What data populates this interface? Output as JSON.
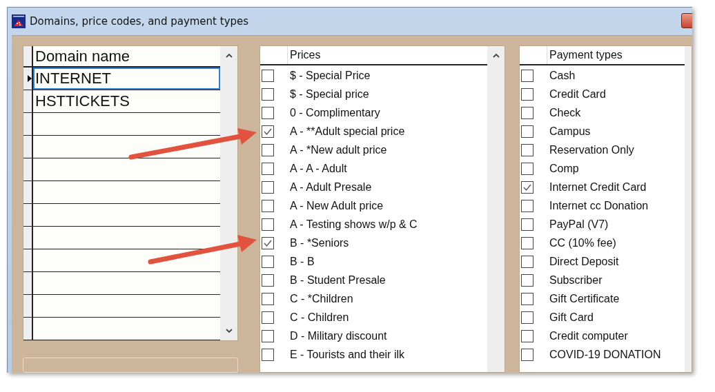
{
  "window": {
    "title": "Domains, price codes, and payment types"
  },
  "domains": {
    "header": "Domain name",
    "rows": [
      {
        "name": "INTERNET",
        "current": true
      },
      {
        "name": "HSTTICKETS",
        "current": false
      }
    ]
  },
  "prices": {
    "header": "Prices",
    "items": [
      {
        "label": "$ - Special Price",
        "checked": false
      },
      {
        "label": "$ - Special price",
        "checked": false
      },
      {
        "label": "0 - Complimentary",
        "checked": false
      },
      {
        "label": "A - **Adult special price",
        "checked": true
      },
      {
        "label": "A - *New adult price",
        "checked": false
      },
      {
        "label": "A - A - Adult",
        "checked": false
      },
      {
        "label": "A - Adult Presale",
        "checked": false
      },
      {
        "label": "A - New Adult price",
        "checked": false
      },
      {
        "label": "A - Testing shows w/p & C",
        "checked": false
      },
      {
        "label": "B - *Seniors",
        "checked": true
      },
      {
        "label": "B - B",
        "checked": false
      },
      {
        "label": "B - Student Presale",
        "checked": false
      },
      {
        "label": "C - *Children",
        "checked": false
      },
      {
        "label": "C - Children",
        "checked": false
      },
      {
        "label": "D - Military discount",
        "checked": false
      },
      {
        "label": "E - Tourists and their ilk",
        "checked": false
      }
    ]
  },
  "payment_types": {
    "header": "Payment types",
    "items": [
      {
        "label": "Cash",
        "checked": false
      },
      {
        "label": "Credit Card",
        "checked": false
      },
      {
        "label": "Check",
        "checked": false
      },
      {
        "label": "Campus",
        "checked": false
      },
      {
        "label": "Reservation Only",
        "checked": false
      },
      {
        "label": "Comp",
        "checked": false
      },
      {
        "label": "Internet Credit Card",
        "checked": true
      },
      {
        "label": "Internet cc Donation",
        "checked": false
      },
      {
        "label": "PayPal (V7)",
        "checked": false
      },
      {
        "label": "CC (10% fee)",
        "checked": false
      },
      {
        "label": "Direct Deposit",
        "checked": false
      },
      {
        "label": "Subscriber",
        "checked": false
      },
      {
        "label": "Gift Certificate",
        "checked": false
      },
      {
        "label": "Gift Card",
        "checked": false
      },
      {
        "label": "Credit computer",
        "checked": false
      },
      {
        "label": "COVID-19 DONATION",
        "checked": false
      }
    ]
  }
}
